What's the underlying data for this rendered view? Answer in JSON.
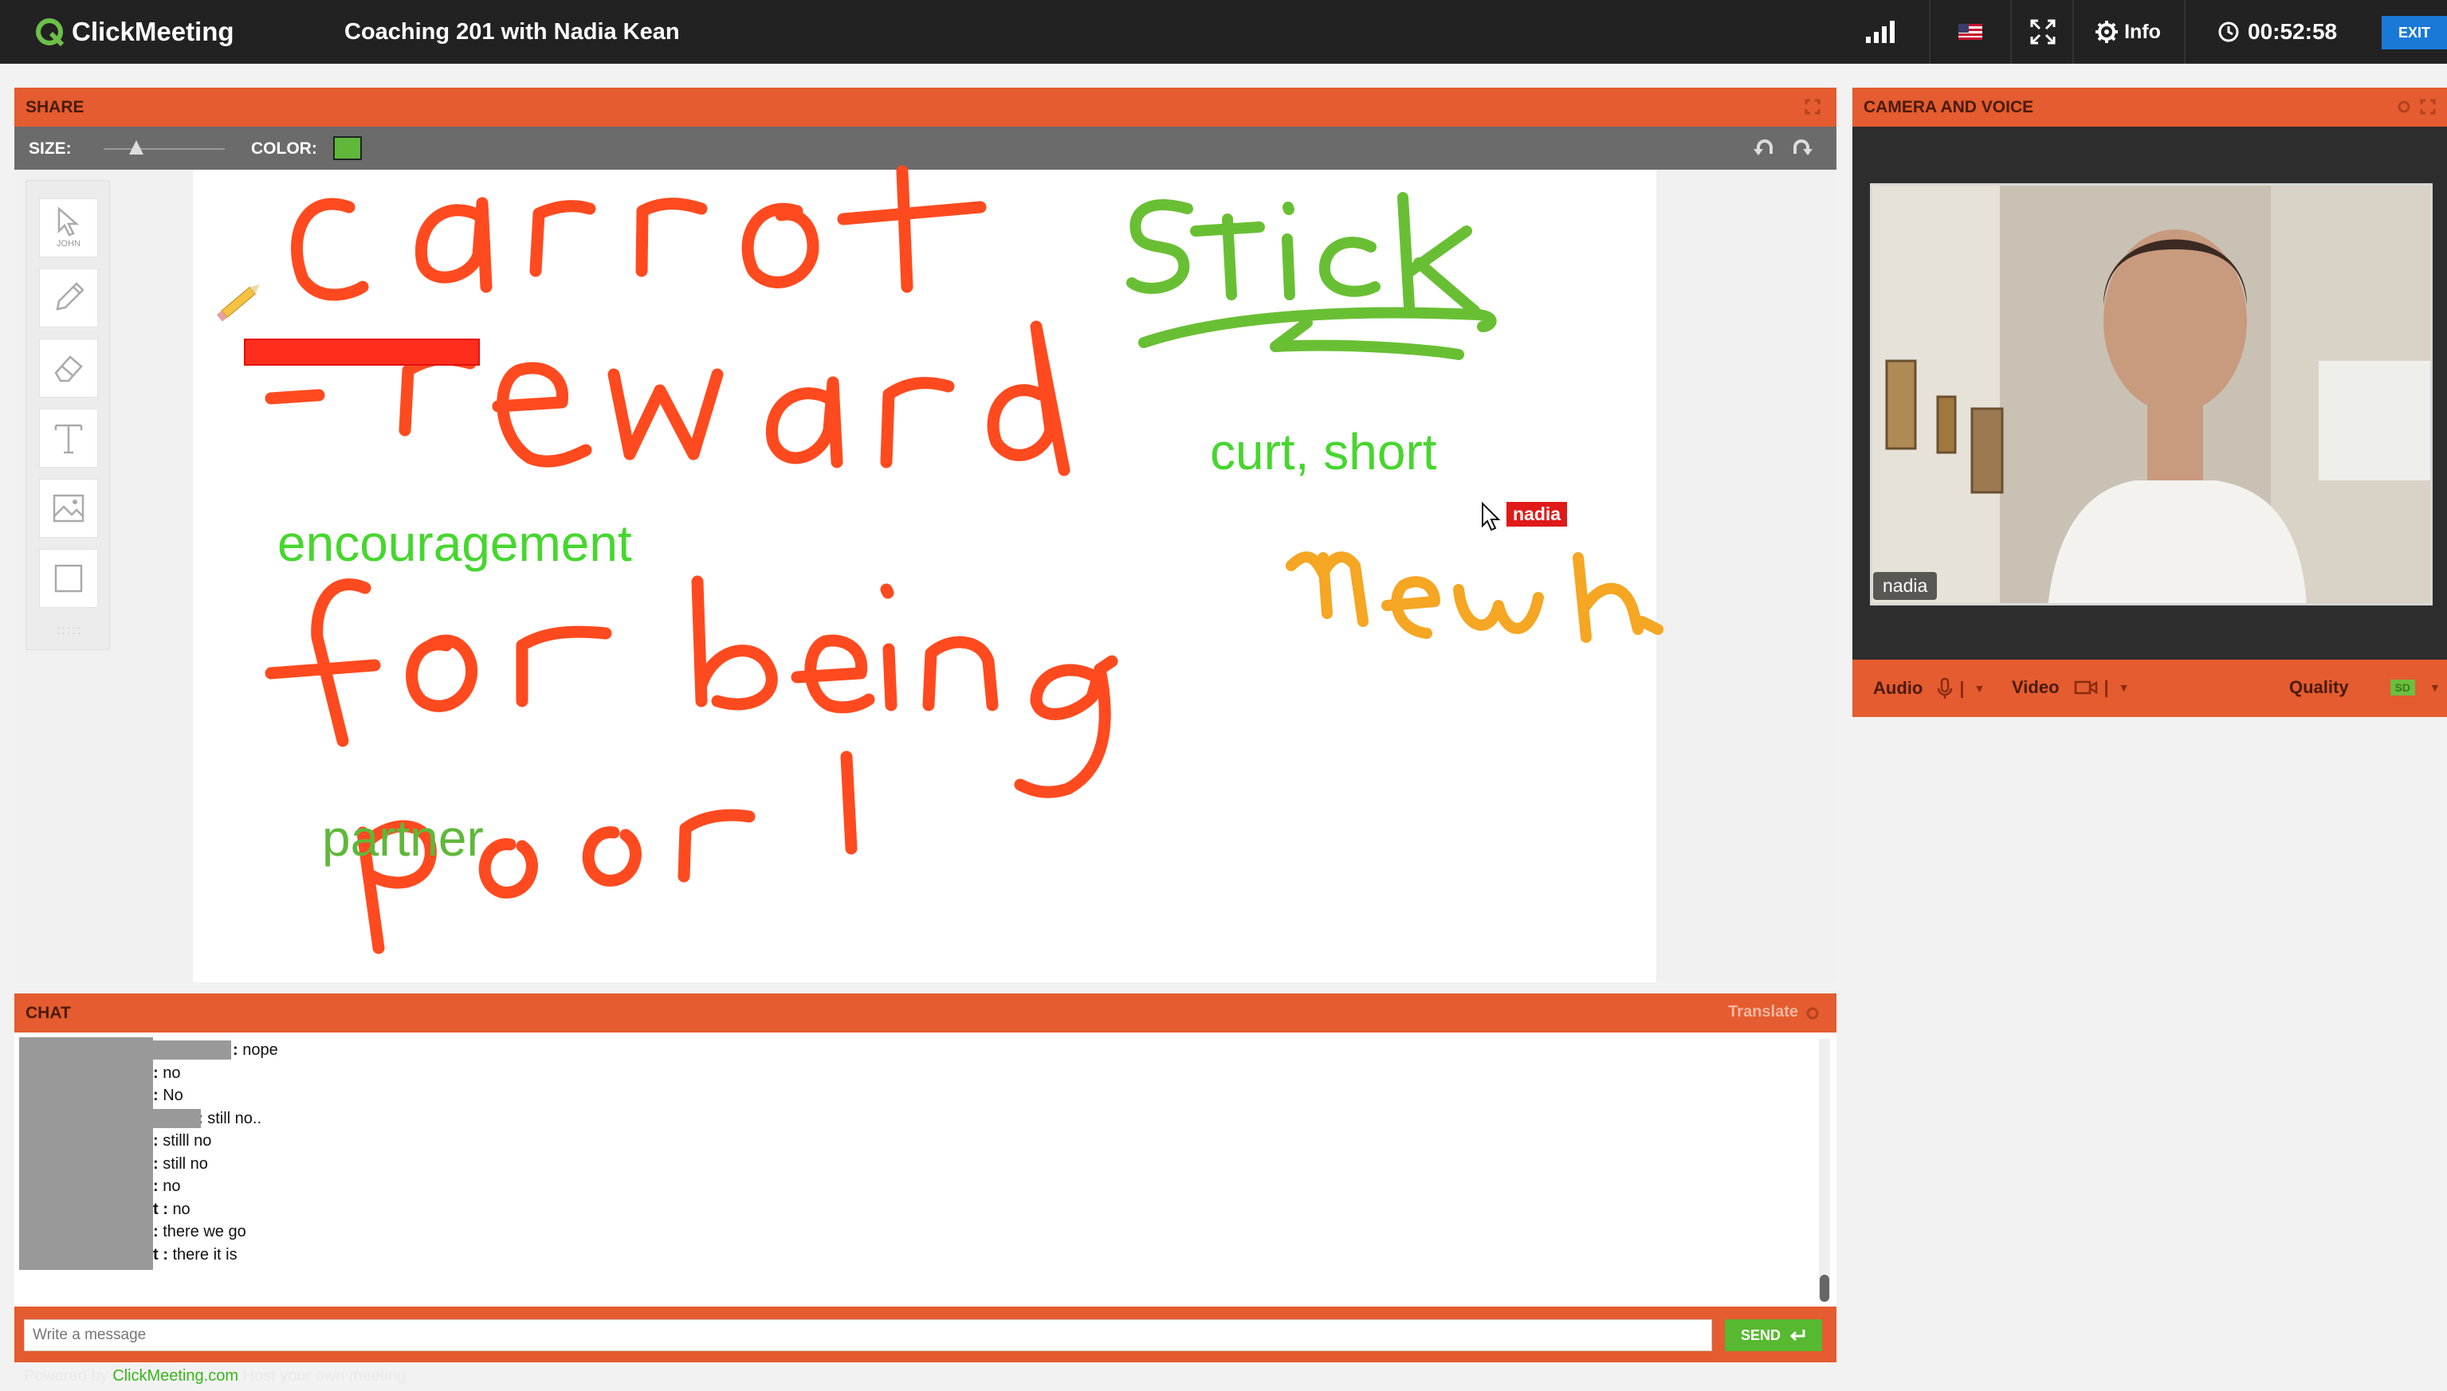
{
  "app": {
    "logo": "ClickMeeting",
    "meeting_title": "Coaching 201 with Nadia Kean",
    "info_label": "Info",
    "timer": "00:52:58",
    "exit_label": "EXIT"
  },
  "share": {
    "header": "SHARE",
    "size_label": "SIZE:",
    "color_label": "COLOR:",
    "selected_color": "#5fb83a",
    "tools": [
      {
        "name": "select",
        "label": "JOHN"
      },
      {
        "name": "pencil",
        "label": ""
      },
      {
        "name": "eraser",
        "label": ""
      },
      {
        "name": "text",
        "label": ""
      },
      {
        "name": "image",
        "label": ""
      },
      {
        "name": "shape",
        "label": ""
      }
    ],
    "canvas_text": {
      "encouragement": "encouragement",
      "curt_short": "curt, short",
      "partner": "partner"
    },
    "handwriting": [
      "carrot",
      "-reward",
      "for being",
      "poor!",
      "Stick",
      "Meh"
    ],
    "cursor_user": "nadia",
    "colors": {
      "red_ink": "#ff4a1f",
      "green_ink": "#69bf34",
      "orange_ink": "#f5a623",
      "typed_green": "#47d62f"
    }
  },
  "camera": {
    "header": "CAMERA AND VOICE",
    "participant": "nadia",
    "audio_label": "Audio",
    "video_label": "Video",
    "quality_label": "Quality",
    "quality_badge": "SD"
  },
  "chat": {
    "header": "CHAT",
    "translate_label": "Translate",
    "messages": [
      {
        "sep": ": ",
        "text": "nope"
      },
      {
        "sep": ": ",
        "text": "no"
      },
      {
        "sep": ": ",
        "text": "No"
      },
      {
        "sep": ": ",
        "text": "still no.."
      },
      {
        "sep": ": ",
        "text": "stilll no"
      },
      {
        "sep": ": ",
        "text": "still no"
      },
      {
        "sep": ": ",
        "text": "no"
      },
      {
        "sep": "t : ",
        "text": "no"
      },
      {
        "sep": ": ",
        "text": "there we go"
      },
      {
        "sep": "t : ",
        "text": "there it is"
      }
    ],
    "input_placeholder": "Write a message",
    "send_label": "SEND"
  },
  "footer": {
    "powered_prefix": "Powered by",
    "link": "ClickMeeting.com",
    "suffix": "Host your own meeting"
  }
}
